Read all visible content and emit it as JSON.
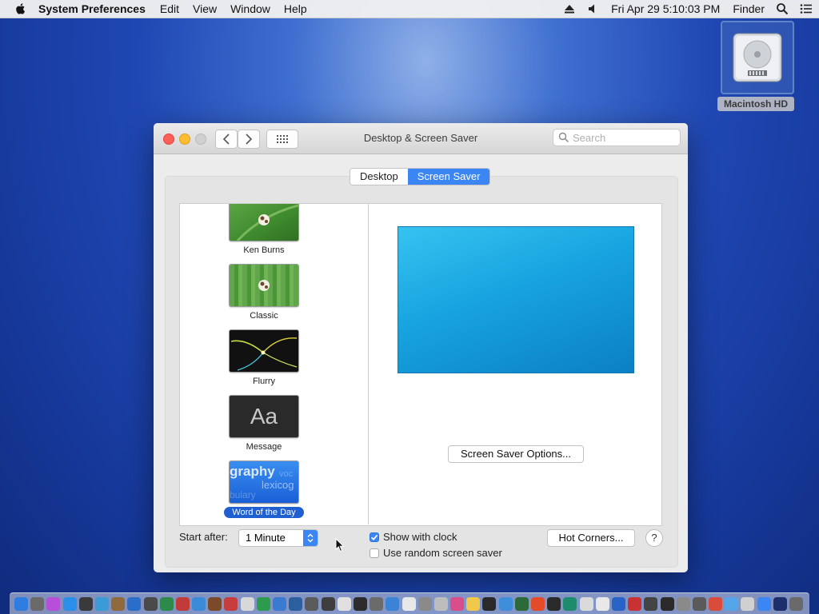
{
  "menubar": {
    "app_name": "System Preferences",
    "menus": [
      "Edit",
      "View",
      "Window",
      "Help"
    ],
    "datetime": "Fri Apr 29  5:10:03 PM",
    "finder": "Finder",
    "icons": [
      "eject-icon",
      "volume-icon",
      "spotlight-icon",
      "notification-center-icon"
    ]
  },
  "desktop": {
    "hd_label": "Macintosh HD"
  },
  "window": {
    "title": "Desktop & Screen Saver",
    "search_placeholder": "Search",
    "tabs": [
      {
        "label": "Desktop",
        "active": false
      },
      {
        "label": "Screen Saver",
        "active": true
      }
    ],
    "savers": [
      {
        "name": "Ken Burns",
        "selected": false,
        "thumb_icon": "ken-burns-thumbnail"
      },
      {
        "name": "Classic",
        "selected": false,
        "thumb_icon": "classic-thumbnail"
      },
      {
        "name": "Flurry",
        "selected": false,
        "thumb_icon": "flurry-thumbnail"
      },
      {
        "name": "Message",
        "selected": false,
        "thumb_text": "Aa"
      },
      {
        "name": "Word of the Day",
        "selected": true,
        "thumb_words": [
          "graphy",
          "voc",
          "lexicog",
          "bulary"
        ]
      }
    ],
    "options_button": "Screen Saver Options...",
    "start_after_label": "Start after:",
    "start_after_value": "1 Minute",
    "show_clock_label": "Show with clock",
    "show_clock_checked": true,
    "random_label": "Use random screen saver",
    "random_checked": false,
    "hot_corners_button": "Hot Corners...",
    "help_button": "?"
  },
  "colors": {
    "accent": "#3b86f2",
    "selection": "#1f5fd0"
  },
  "dock": {
    "icon_colors": [
      "#2f7de1",
      "#6a6a6a",
      "#b84fd8",
      "#2a8fe8",
      "#3a3a3a",
      "#3a9bd6",
      "#8f6a3c",
      "#2a6ec9",
      "#4a4a4a",
      "#2d8a4a",
      "#c23b3b",
      "#3b8ad8",
      "#7a4a2a",
      "#c73c3c",
      "#d8d8d8",
      "#2d9b4e",
      "#3a7ad0",
      "#2b5f9f",
      "#5b5b5b",
      "#3e3e3e",
      "#e0e0e0",
      "#2c2c2c",
      "#6b6b6b",
      "#3a83d6",
      "#e8e8e8",
      "#8a8a8a",
      "#bdbdbd",
      "#d84d8a",
      "#f0c84a",
      "#2a2a2a",
      "#3e8ed9",
      "#2c6a3a",
      "#e44b2a",
      "#2a2a2a",
      "#1e8c6c",
      "#dadada",
      "#e8e8e8",
      "#2a63c8",
      "#c83232",
      "#444444",
      "#2a2a2a",
      "#8a8a8a",
      "#5a5a5a",
      "#d94b3b",
      "#56a5e8",
      "#d0d0d0",
      "#3b86f2",
      "#1d2f6a",
      "#6a6a6a"
    ]
  }
}
